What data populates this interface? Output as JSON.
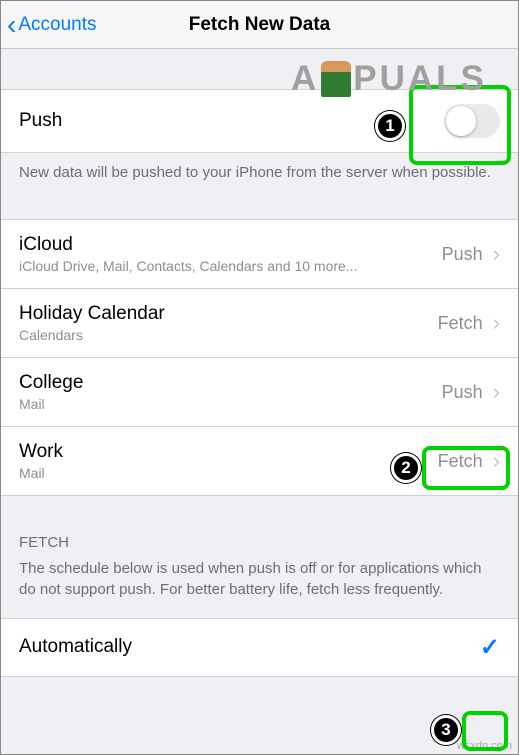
{
  "header": {
    "back_label": "Accounts",
    "title": "Fetch New Data"
  },
  "push_section": {
    "label": "Push",
    "footer": "New data will be pushed to your iPhone from the server when possible."
  },
  "accounts": [
    {
      "name": "iCloud",
      "detail": "iCloud Drive, Mail, Contacts, Calendars and 10 more...",
      "value": "Push"
    },
    {
      "name": "Holiday Calendar",
      "detail": "Calendars",
      "value": "Fetch"
    },
    {
      "name": "College",
      "detail": "Mail",
      "value": "Push"
    },
    {
      "name": "Work",
      "detail": "Mail",
      "value": "Fetch"
    }
  ],
  "fetch_section": {
    "header": "FETCH",
    "footer": "The schedule below is used when push is off or for applications which do not support push. For better battery life, fetch less frequently."
  },
  "schedule": {
    "option_label": "Automatically"
  },
  "annotations": {
    "badge1": "1",
    "badge2": "2",
    "badge3": "3"
  },
  "watermark": {
    "pre": "A",
    "post": "PUALS",
    "credit": "wsxdn.com"
  }
}
